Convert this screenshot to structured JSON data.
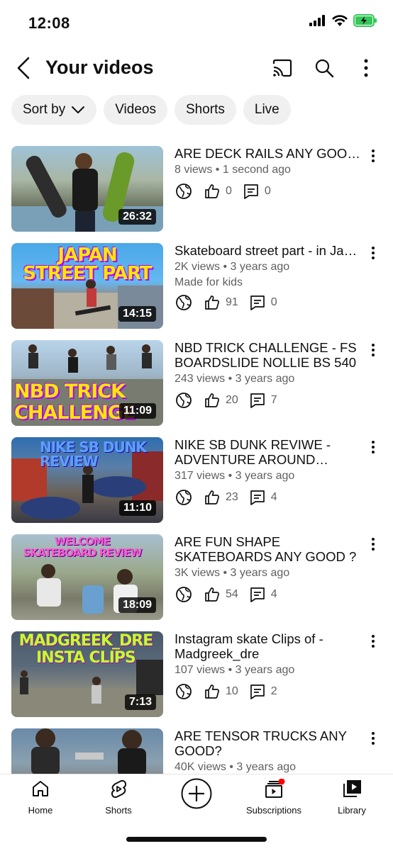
{
  "status": {
    "time": "12:08"
  },
  "header": {
    "title": "Your videos",
    "icons": [
      "back-icon",
      "cast-icon",
      "search-icon",
      "more-vertical-icon"
    ]
  },
  "chips": [
    {
      "label": "Sort by"
    },
    {
      "label": "Videos"
    },
    {
      "label": "Shorts"
    },
    {
      "label": "Live"
    }
  ],
  "videos": [
    {
      "title": "ARE DECK RAILS ANY GOOD?",
      "views": "8 views",
      "age": "1 second ago",
      "likes": "0",
      "comments": "0",
      "duration": "26:32",
      "caption": ""
    },
    {
      "title": "Skateboard street part - in Japan",
      "views": "2K views",
      "age": "3 years ago",
      "kids": "Made for kids",
      "likes": "91",
      "comments": "0",
      "duration": "14:15",
      "caption": "JAPAN STREET PART"
    },
    {
      "title": "NBD TRICK CHALLENGE - FS BOARDSLIDE NOLLIE BS 540",
      "views": "243 views",
      "age": "3 years ago",
      "likes": "20",
      "comments": "7",
      "duration": "11:09",
      "caption": "NBD TRICK CHALLENGE"
    },
    {
      "title": "NIKE SB DUNK REVIWE - ADVENTURE AROUND TOKYO",
      "views": "317 views",
      "age": "3 years ago",
      "likes": "23",
      "comments": "4",
      "duration": "11:10",
      "caption": "NIKE SB DUNK REVIEW"
    },
    {
      "title": "ARE FUN SHAPE SKATEBOARDS ANY GOOD ?",
      "views": "3K views",
      "age": "3 years ago",
      "likes": "54",
      "comments": "4",
      "duration": "18:09",
      "caption": "WELCOME SKATEBOARD REVIEW"
    },
    {
      "title": "Instagram skate Clips of - Madgreek_dre",
      "views": "107 views",
      "age": "3 years ago",
      "likes": "10",
      "comments": "2",
      "duration": "7:13",
      "caption": "MADGREEK_DRE INSTA CLIPS"
    },
    {
      "title": "ARE TENSOR TRUCKS ANY GOOD?",
      "views": "40K views",
      "age": "3 years ago",
      "likes": "",
      "comments": "",
      "duration": "",
      "caption": ""
    }
  ],
  "nav": [
    {
      "label": "Home",
      "icon": "home-icon"
    },
    {
      "label": "Shorts",
      "icon": "shorts-icon"
    },
    {
      "label": "",
      "icon": "create-icon"
    },
    {
      "label": "Subscriptions",
      "icon": "subscriptions-icon"
    },
    {
      "label": "Library",
      "icon": "library-icon"
    }
  ],
  "colors": {
    "accent": "#ff0000",
    "text": "#0f0f0f",
    "secondary": "#606060",
    "chip": "#f0f0f0",
    "battery": "#34c759"
  }
}
